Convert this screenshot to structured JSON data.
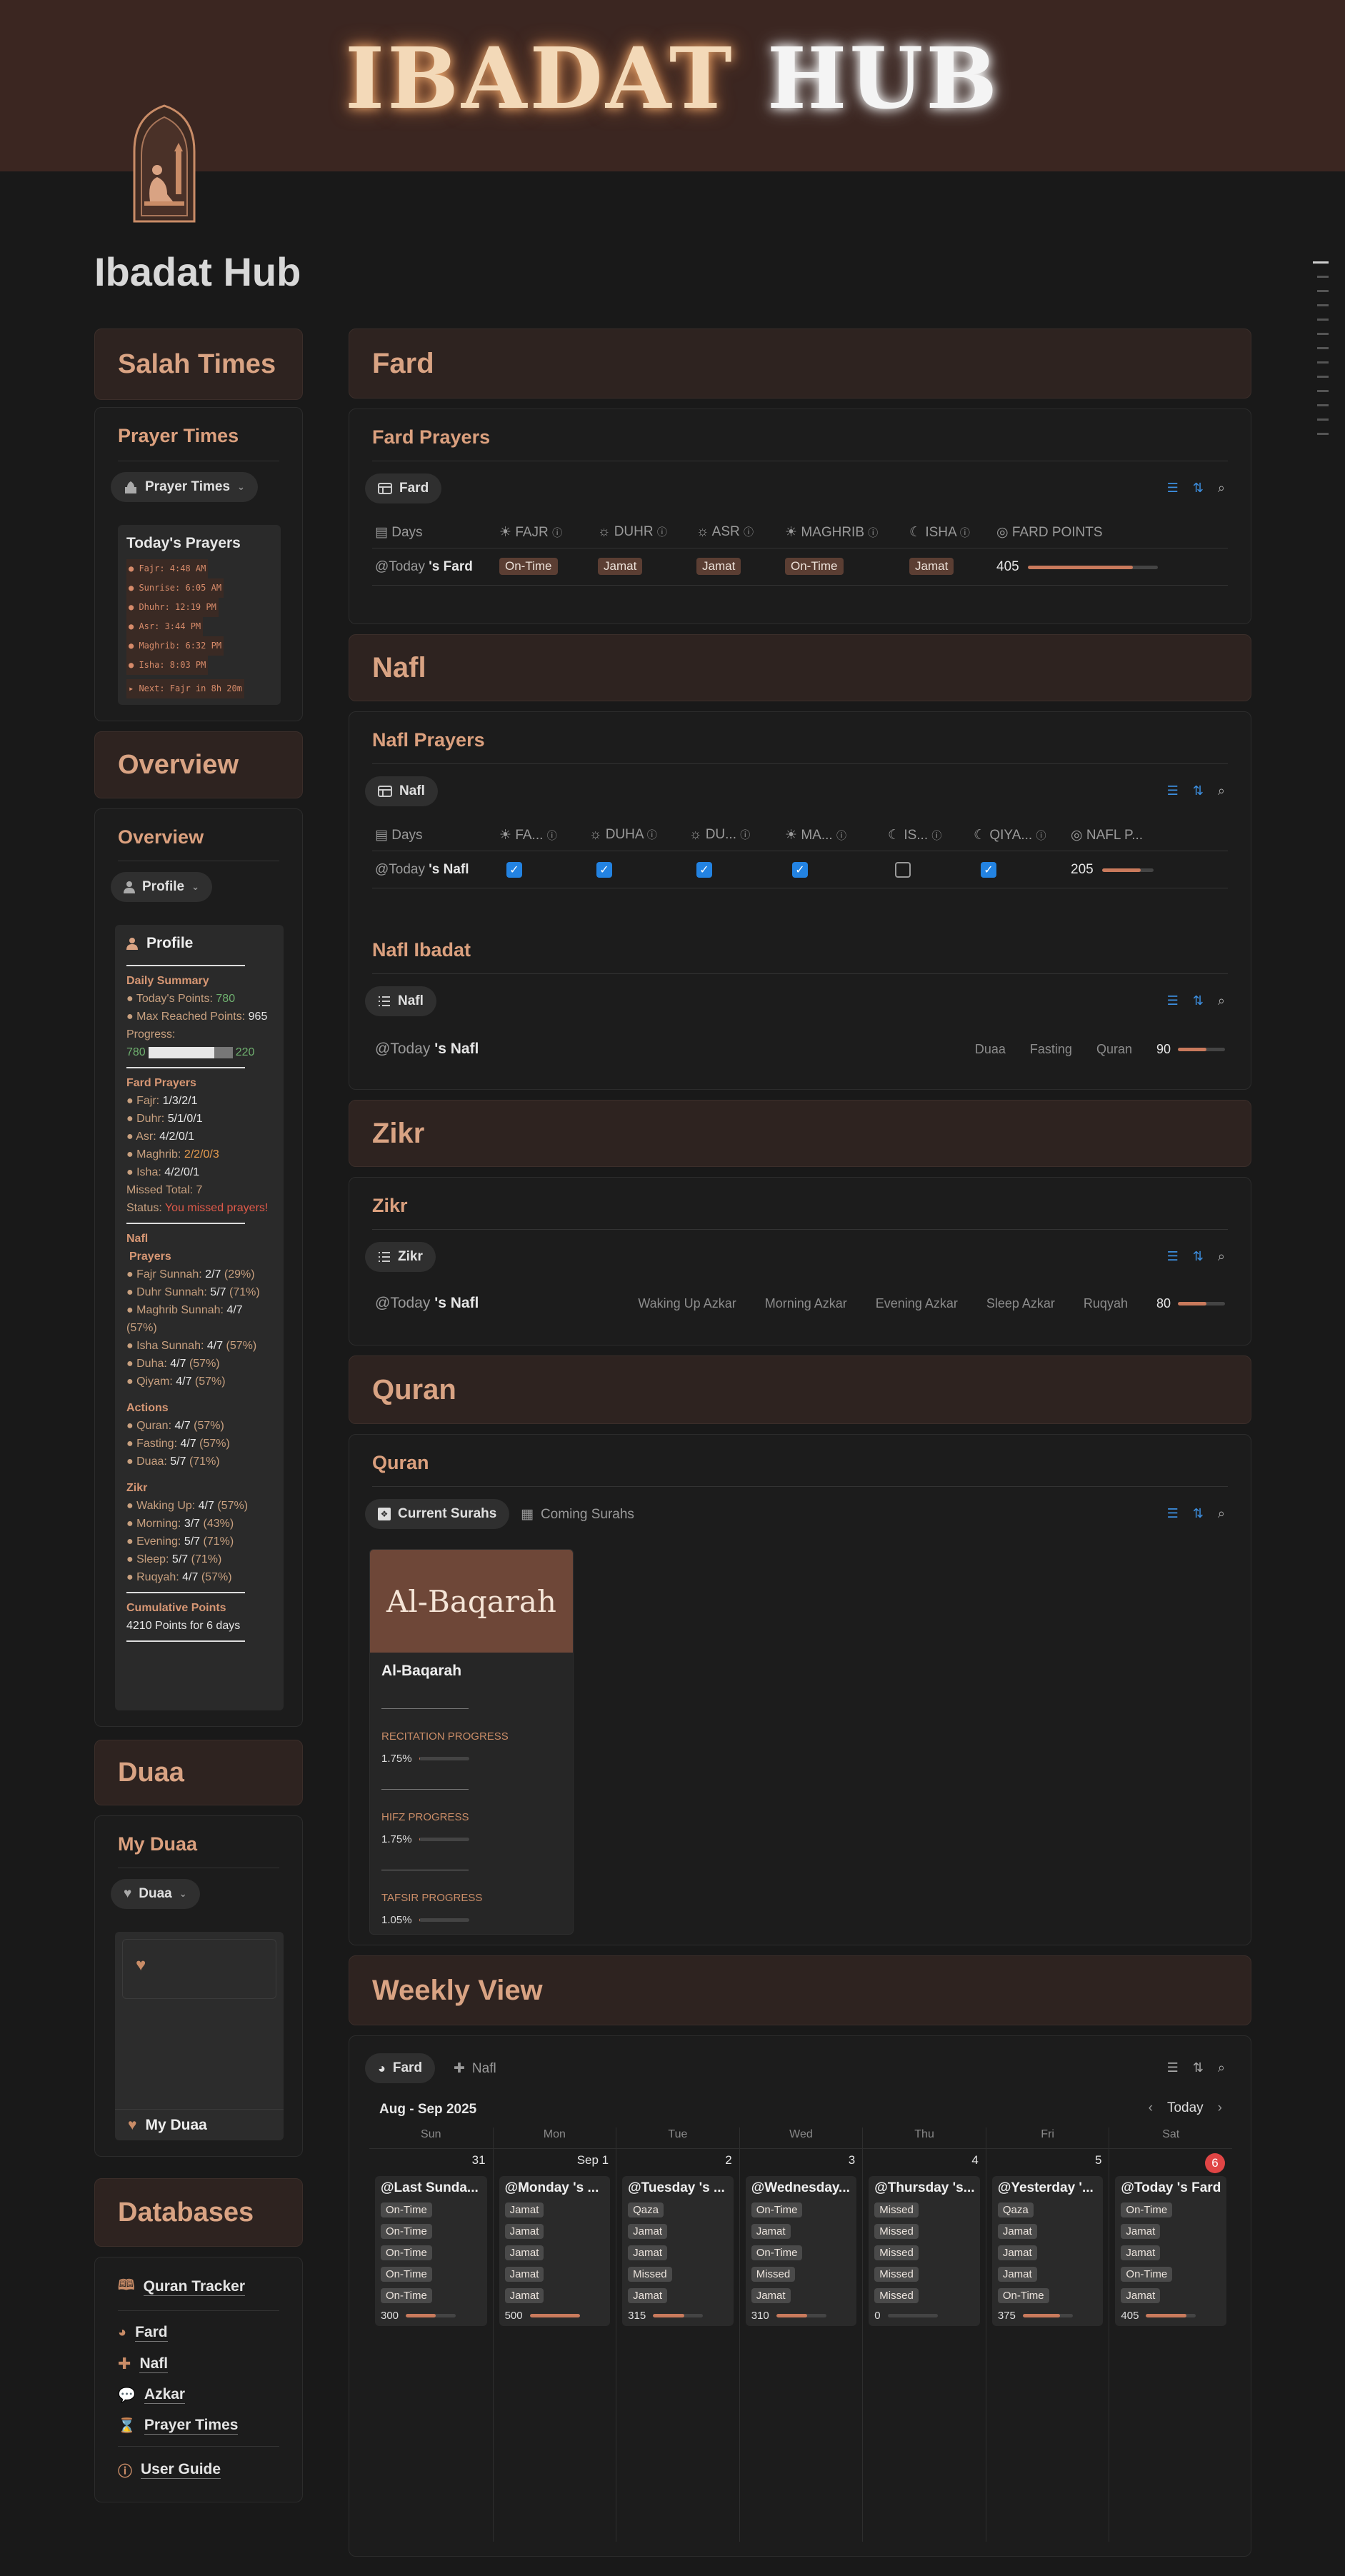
{
  "banner": {
    "title_word1": "IBADAT",
    "title_word2": "HUB"
  },
  "page": {
    "title": "Ibadat Hub"
  },
  "colors": {
    "accent": "#d9a383",
    "section_bg": "#2e2320",
    "banner_bg": "#3b2621",
    "tag_bg": "#5b3e33",
    "checkbox": "#2383e2",
    "today_badge": "#e04545"
  },
  "sidebar": {
    "salah": {
      "heading": "Salah Times",
      "panel_title": "Prayer Times",
      "view_label": "Prayer Times",
      "card_title": "Today's Prayers",
      "times": [
        "Fajr: 4:48 AM",
        "Sunrise: 6:05 AM",
        "Dhuhr: 12:19 PM",
        "Asr: 3:44 PM",
        "Maghrib: 6:32 PM",
        "Isha: 8:03 PM"
      ],
      "next": "Next: Fajr in 8h 20m"
    },
    "overview": {
      "heading": "Overview",
      "panel_title": "Overview",
      "view_label": "Profile",
      "card_title": "Profile",
      "daily_summary": "Daily Summary",
      "todays_points_label": "● Today's Points:",
      "todays_points": "780",
      "max_points_label": "● Max Reached Points:",
      "max_points": "965",
      "progress_label": "Progress:",
      "progress_left": "780",
      "progress_right": "220",
      "progress_fraction": 0.78,
      "fard_heading": "Fard Prayers",
      "fard_rows": [
        {
          "label": "● Fajr: ",
          "v": "1/3/2/1"
        },
        {
          "label": "● Duhr: ",
          "v": "5/1/0/1"
        },
        {
          "label": "● Asr: ",
          "v": "4/2/0/1"
        },
        {
          "label": "● Maghrib: ",
          "v": "2/2/0/3"
        },
        {
          "label": "● Isha: ",
          "v": "4/2/0/1"
        }
      ],
      "missed_total": "Missed Total: 7",
      "status_label": "Status: ",
      "status": "You missed prayers!",
      "nafl_heading": "Nafl",
      "nafl_sub": "Prayers",
      "nafl_rows": [
        {
          "label": "● Fajr Sunnah: ",
          "v": "2/7",
          "p": " (29%)"
        },
        {
          "label": "● Duhr Sunnah: ",
          "v": "5/7",
          "p": " (71%)"
        },
        {
          "label": "● Maghrib Sunnah: ",
          "v": "4/7",
          "p": " (57%)"
        },
        {
          "label": "● Isha Sunnah: ",
          "v": "4/7",
          "p": " (57%)"
        },
        {
          "label": "● Duha: ",
          "v": "4/7",
          "p": " (57%)"
        },
        {
          "label": "● Qiyam: ",
          "v": "4/7",
          "p": " (57%)"
        }
      ],
      "actions_heading": "Actions",
      "actions_rows": [
        {
          "label": "● Quran: ",
          "v": "4/7",
          "p": " (57%)"
        },
        {
          "label": "● Fasting: ",
          "v": "4/7",
          "p": " (57%)"
        },
        {
          "label": "● Duaa: ",
          "v": "5/7",
          "p": " (71%)"
        }
      ],
      "zikr_heading": "Zikr",
      "zikr_rows": [
        {
          "label": "● Waking Up: ",
          "v": "4/7",
          "p": " (57%)"
        },
        {
          "label": "● Morning: ",
          "v": "3/7",
          "p": " (43%)"
        },
        {
          "label": "● Evening: ",
          "v": "5/7",
          "p": " (71%)"
        },
        {
          "label": "● Sleep: ",
          "v": "5/7",
          "p": " (71%)"
        },
        {
          "label": "● Ruqyah: ",
          "v": "4/7",
          "p": " (57%)"
        }
      ],
      "cumulative_heading": "Cumulative Points",
      "cumulative_value": "4210 Points for 6 days"
    },
    "duaa": {
      "heading": "Duaa",
      "panel_title": "My Duaa",
      "view_label": "Duaa",
      "card_title": "My Duaa"
    },
    "databases": {
      "heading": "Databases",
      "quran_tracker": "Quran Tracker",
      "items": [
        "Fard",
        "Nafl",
        "Azkar",
        "Prayer Times"
      ],
      "user_guide": "User Guide"
    }
  },
  "fard": {
    "heading": "Fard",
    "panel_title": "Fard Prayers",
    "view_label": "Fard",
    "columns": [
      "Days",
      "FAJR",
      "DUHR",
      "ASR",
      "MAGHRIB",
      "ISHA",
      "FARD POINTS"
    ],
    "row": {
      "date": "@Today",
      "suffix": "'s Fard",
      "values": [
        "On-Time",
        "Jamat",
        "Jamat",
        "On-Time",
        "Jamat"
      ],
      "points": "405",
      "points_fraction": 0.81
    }
  },
  "nafl": {
    "heading": "Nafl",
    "panel_title": "Nafl Prayers",
    "view_label": "Nafl",
    "columns": [
      "Days",
      "FA...",
      "DUHA",
      "DU...",
      "MA...",
      "IS...",
      "QIYA...",
      "NAFL P..."
    ],
    "row": {
      "date": "@Today",
      "suffix": "'s Nafl",
      "checks": [
        true,
        true,
        true,
        true,
        false,
        true
      ],
      "points": "205",
      "points_fraction": 0.75
    },
    "ibadat_title": "Nafl Ibadat",
    "ibadat_view": "Nafl",
    "ibadat_row": {
      "date": "@Today",
      "suffix": "'s Nafl",
      "tags": [
        "Duaa",
        "Fasting",
        "Quran"
      ],
      "points": "90",
      "points_fraction": 0.6
    }
  },
  "zikr": {
    "heading": "Zikr",
    "panel_title": "Zikr",
    "view_label": "Zikr",
    "row": {
      "date": "@Today",
      "suffix": "'s Nafl",
      "tags": [
        "Waking Up Azkar",
        "Morning Azkar",
        "Evening Azkar",
        "Sleep Azkar",
        "Ruqyah"
      ],
      "points": "80",
      "points_fraction": 0.6
    }
  },
  "quran": {
    "heading": "Quran",
    "panel_title": "Quran",
    "view_current": "Current Surahs",
    "view_coming": "Coming Surahs",
    "card": {
      "cover": "Al-Baqarah",
      "name": "Al-Baqarah",
      "props": [
        {
          "label": "RECITATION PROGRESS",
          "value": "1.75%",
          "fraction": 0.0175
        },
        {
          "label": "HIFZ PROGRESS",
          "value": "1.75%",
          "fraction": 0.0175
        },
        {
          "label": "TAFSIR PROGRESS",
          "value": "1.05%",
          "fraction": 0.0105
        }
      ]
    }
  },
  "weekly": {
    "heading": "Weekly View",
    "view_fard": "Fard",
    "view_nafl": "Nafl",
    "month": "Aug - Sep 2025",
    "today_btn": "Today",
    "weekdays": [
      "Sun",
      "Mon",
      "Tue",
      "Wed",
      "Thu",
      "Fri",
      "Sat"
    ],
    "days": [
      {
        "num": "31",
        "title": "@Last Sunda...",
        "tags": [
          "On-Time",
          "On-Time",
          "On-Time",
          "On-Time",
          "On-Time"
        ],
        "points": "300",
        "fraction": 0.6
      },
      {
        "num": "Sep 1",
        "title": "@Monday 's ...",
        "tags": [
          "Jamat",
          "Jamat",
          "Jamat",
          "Jamat",
          "Jamat"
        ],
        "points": "500",
        "fraction": 1.0
      },
      {
        "num": "2",
        "title": "@Tuesday 's ...",
        "tags": [
          "Qaza",
          "Jamat",
          "Jamat",
          "Missed",
          "Jamat"
        ],
        "points": "315",
        "fraction": 0.63
      },
      {
        "num": "3",
        "title": "@Wednesday...",
        "tags": [
          "On-Time",
          "Jamat",
          "On-Time",
          "Missed",
          "Jamat"
        ],
        "points": "310",
        "fraction": 0.62
      },
      {
        "num": "4",
        "title": "@Thursday 's...",
        "tags": [
          "Missed",
          "Missed",
          "Missed",
          "Missed",
          "Missed"
        ],
        "points": "0",
        "fraction": 0.0
      },
      {
        "num": "5",
        "title": "@Yesterday '...",
        "tags": [
          "Qaza",
          "Jamat",
          "Jamat",
          "Jamat",
          "On-Time"
        ],
        "points": "375",
        "fraction": 0.75
      },
      {
        "num": "6",
        "title": "@Today 's Fard",
        "tags": [
          "On-Time",
          "Jamat",
          "Jamat",
          "On-Time",
          "Jamat"
        ],
        "points": "405",
        "fraction": 0.81,
        "today": true
      }
    ]
  }
}
